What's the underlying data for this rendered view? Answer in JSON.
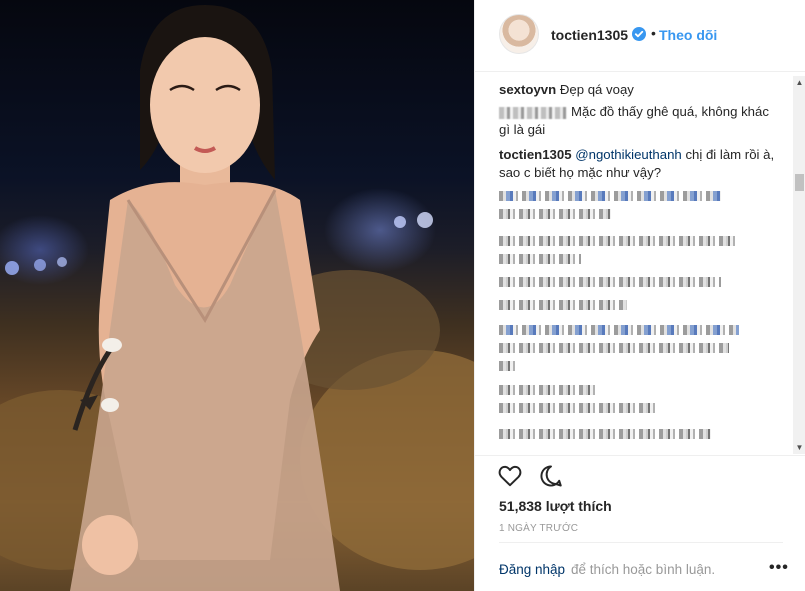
{
  "post": {
    "username": "toctien1305",
    "separator": "•",
    "follow_label": "Theo dõi"
  },
  "comments": [
    {
      "user": "sextoyvn",
      "text": "Đẹp qá voạy"
    },
    {
      "user": "",
      "text": "Mặc đồ thấy ghê quá, không khác gì là gái"
    },
    {
      "user": "toctien1305",
      "mention": "@ngothikieuthanh",
      "text": "chị đi làm rồi à, sao c biết họ mặc như vậy?"
    }
  ],
  "icons": {
    "verified": "verified-badge-icon",
    "like": "heart-icon",
    "comment": "comment-bubble-icon",
    "more": "more-options-icon"
  },
  "stats": {
    "likes_text": "51,838 lượt thích",
    "time_ago": "1 NGÀY TRƯỚC"
  },
  "footer": {
    "login_link": "Đăng nhập",
    "login_rest": "để thích hoặc bình luận.",
    "more_label": "•••"
  },
  "colors": {
    "link": "#003569",
    "follow": "#3897f0",
    "verified": "#3897f0",
    "muted": "#999999",
    "text": "#262626"
  }
}
